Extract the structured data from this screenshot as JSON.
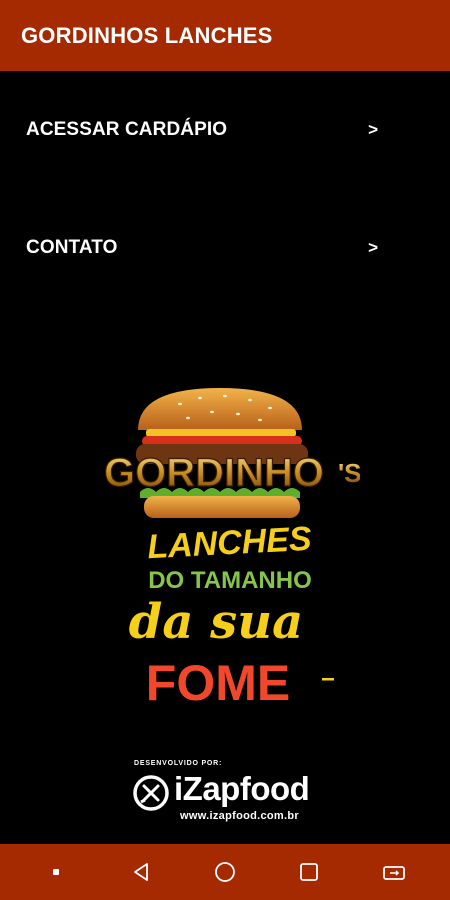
{
  "app_bar": {
    "title": "GORDINHOS LANCHES"
  },
  "menu": {
    "items": [
      {
        "label": "ACESSAR CARDÁPIO",
        "chevron": ">"
      },
      {
        "label": "CONTATO",
        "chevron": ">"
      }
    ]
  },
  "logo": {
    "line1": "GORDINHO",
    "line2": "LANCHES",
    "line3": "DO TAMANHO",
    "line4": "da sua",
    "line5": "FOME"
  },
  "credit": {
    "developed_by": "DESENVOLVIDO POR:",
    "brand": "iZapfood",
    "url": "www.izapfood.com.br"
  },
  "nav": {
    "icons": [
      "menu-dot-icon",
      "back-icon",
      "home-icon",
      "recents-icon",
      "rotate-icon"
    ]
  },
  "colors": {
    "bar": "#a52a02",
    "background": "#000000",
    "text": "#ffffff",
    "logo_yellow": "#f6cf1a",
    "logo_green": "#86c54a",
    "logo_red": "#f1472a"
  }
}
